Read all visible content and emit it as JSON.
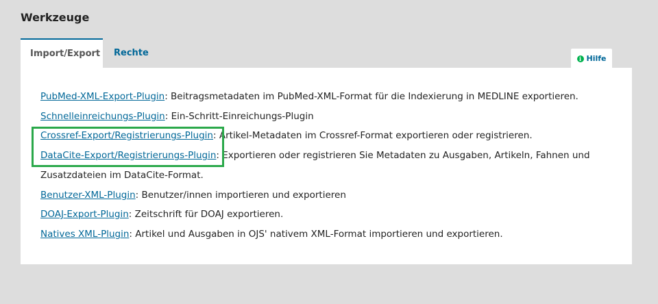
{
  "page": {
    "title": "Werkzeuge"
  },
  "tabs": [
    {
      "label": "Import/Export",
      "active": true
    },
    {
      "label": "Rechte",
      "active": false
    }
  ],
  "help": {
    "label": "Hilfe",
    "icon": "info-icon"
  },
  "plugins": [
    {
      "name": "PubMed-XML-Export-Plugin",
      "description": ": Beitragsmetadaten im PubMed-XML-Format für die Indexierung in MEDLINE exportieren."
    },
    {
      "name": "Schnelleinreichungs-Plugin",
      "description": ": Ein-Schritt-Einreichungs-Plugin"
    },
    {
      "name": "Crossref-Export/Registrierungs-Plugin",
      "description": ": Artikel-Metadaten im Crossref-Format exportieren oder registrieren."
    },
    {
      "name": "DataCite-Export/Registrierungs-Plugin",
      "description": ": Exportieren oder registrieren Sie Metadaten zu Ausgaben, Artikeln, Fahnen und Zusatzdateien im DataCite-Format."
    },
    {
      "name": "Benutzer-XML-Plugin",
      "description": ": Benutzer/innen importieren und exportieren"
    },
    {
      "name": "DOAJ-Export-Plugin",
      "description": ": Zeitschrift für DOAJ exportieren."
    },
    {
      "name": "Natives XML-Plugin",
      "description": ": Artikel und Ausgaben in OJS' nativem XML-Format importieren und exportieren."
    }
  ],
  "colors": {
    "background": "#dddddd",
    "link": "#006798",
    "highlight": "#2aa84a",
    "help_icon": "#00b24e"
  }
}
